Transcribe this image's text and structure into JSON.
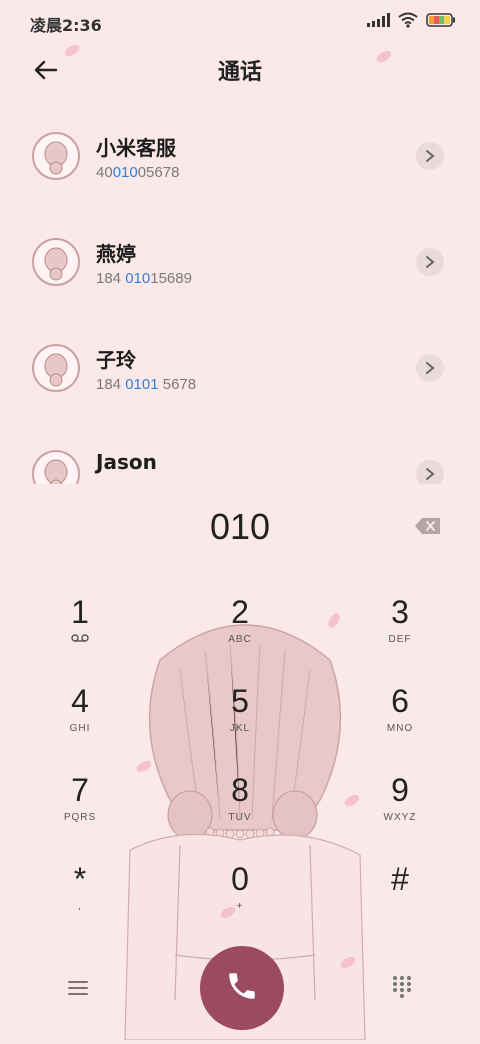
{
  "status": {
    "time": "凌晨2:36"
  },
  "header": {
    "title": "通话"
  },
  "contacts": [
    {
      "name": "小米客服",
      "number_pre": "40",
      "number_hl": "010",
      "number_post": "05678"
    },
    {
      "name": "燕婷",
      "number_pre": "184 ",
      "number_hl": "010",
      "number_post": "15689"
    },
    {
      "name": "子玲",
      "number_pre": "184 ",
      "number_hl": "0101",
      "number_post": " 5678"
    },
    {
      "name": "Jason",
      "number_pre": "",
      "number_hl": "",
      "number_post": ""
    }
  ],
  "dialer": {
    "value": "010",
    "keys": [
      {
        "digit": "1",
        "letters": ""
      },
      {
        "digit": "2",
        "letters": "ABC"
      },
      {
        "digit": "3",
        "letters": "DEF"
      },
      {
        "digit": "4",
        "letters": "GHI"
      },
      {
        "digit": "5",
        "letters": "JKL"
      },
      {
        "digit": "6",
        "letters": "MNO"
      },
      {
        "digit": "7",
        "letters": "PQRS"
      },
      {
        "digit": "8",
        "letters": "TUV"
      },
      {
        "digit": "9",
        "letters": "WXYZ"
      },
      {
        "digit": "*",
        "letters": ","
      },
      {
        "digit": "0",
        "letters": "+"
      },
      {
        "digit": "#",
        "letters": ""
      }
    ]
  },
  "colors": {
    "background": "#fbe9e9",
    "highlight": "#2f7fd7",
    "call_button": "#9c4a61"
  },
  "icons": {
    "back": "arrow-left-icon",
    "chevron": "chevron-right-icon",
    "backspace": "backspace-icon",
    "voicemail": "voicemail-icon",
    "menu": "menu-icon",
    "call": "phone-icon",
    "dialpad": "dialpad-icon"
  }
}
